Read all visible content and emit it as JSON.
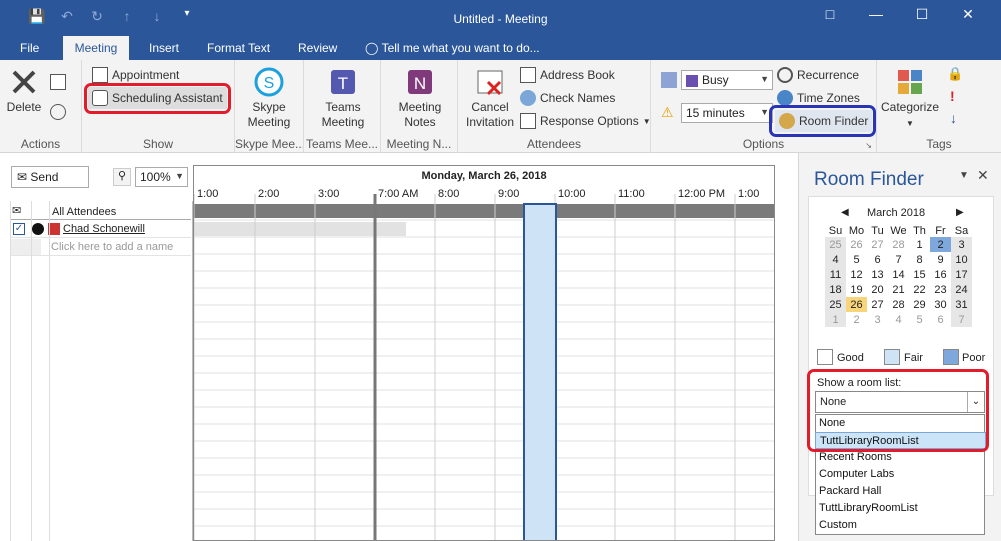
{
  "window": {
    "title": "Untitled - Meeting"
  },
  "tabs": [
    "File",
    "Meeting",
    "Insert",
    "Format Text",
    "Review"
  ],
  "tell_me": "Tell me what you want to do...",
  "ribbon": {
    "actions": {
      "delete": "Delete",
      "label": "Actions"
    },
    "show": {
      "appointment": "Appointment",
      "scheduling": "Scheduling Assistant",
      "label": "Show"
    },
    "skype": {
      "btn1": "Skype",
      "btn2": "Meeting",
      "label": "Skype Mee..."
    },
    "teams": {
      "btn1": "Teams",
      "btn2": "Meeting",
      "label": "Teams Mee..."
    },
    "notes": {
      "btn1": "Meeting",
      "btn2": "Notes",
      "label": "Meeting N..."
    },
    "attendees": {
      "cancel1": "Cancel",
      "cancel2": "Invitation",
      "address_book": "Address Book",
      "check_names": "Check Names",
      "response": "Response Options",
      "label": "Attendees"
    },
    "options": {
      "busy": "Busy",
      "reminder": "15 minutes",
      "recurrence": "Recurrence",
      "time_zones": "Time Zones",
      "room_finder": "Room Finder",
      "label": "Options"
    },
    "tags": {
      "categorize": "Categorize",
      "label": "Tags"
    }
  },
  "toolbar": {
    "send": "Send",
    "zoom": "100%"
  },
  "attendees": {
    "header": "All Attendees",
    "person": "Chad Schonewill",
    "add_placeholder": "Click here to add a name"
  },
  "grid": {
    "date": "Monday, March 26, 2018",
    "times": [
      "1:00",
      "2:00",
      "3:00",
      "7:00 AM",
      "8:00",
      "9:00",
      "10:00",
      "11:00",
      "12:00 PM",
      "1:00"
    ]
  },
  "room_finder": {
    "title": "Room Finder",
    "month": "March 2018",
    "days": [
      "Su",
      "Mo",
      "Tu",
      "We",
      "Th",
      "Fr",
      "Sa"
    ],
    "weeks": [
      [
        "25",
        "26",
        "27",
        "28",
        "1",
        "2",
        "3"
      ],
      [
        "4",
        "5",
        "6",
        "7",
        "8",
        "9",
        "10"
      ],
      [
        "11",
        "12",
        "13",
        "14",
        "15",
        "16",
        "17"
      ],
      [
        "18",
        "19",
        "20",
        "21",
        "22",
        "23",
        "24"
      ],
      [
        "25",
        "26",
        "27",
        "28",
        "29",
        "30",
        "31"
      ],
      [
        "1",
        "2",
        "3",
        "4",
        "5",
        "6",
        "7"
      ]
    ],
    "legend": {
      "good": "Good",
      "fair": "Fair",
      "poor": "Poor"
    },
    "room_list_label": "Show a room list:",
    "selected": "None",
    "options": [
      "None",
      "TuttLibraryRoomList",
      "Recent Rooms",
      "Computer Labs",
      "Packard Hall",
      "TuttLibraryRoomList",
      "Custom"
    ]
  }
}
